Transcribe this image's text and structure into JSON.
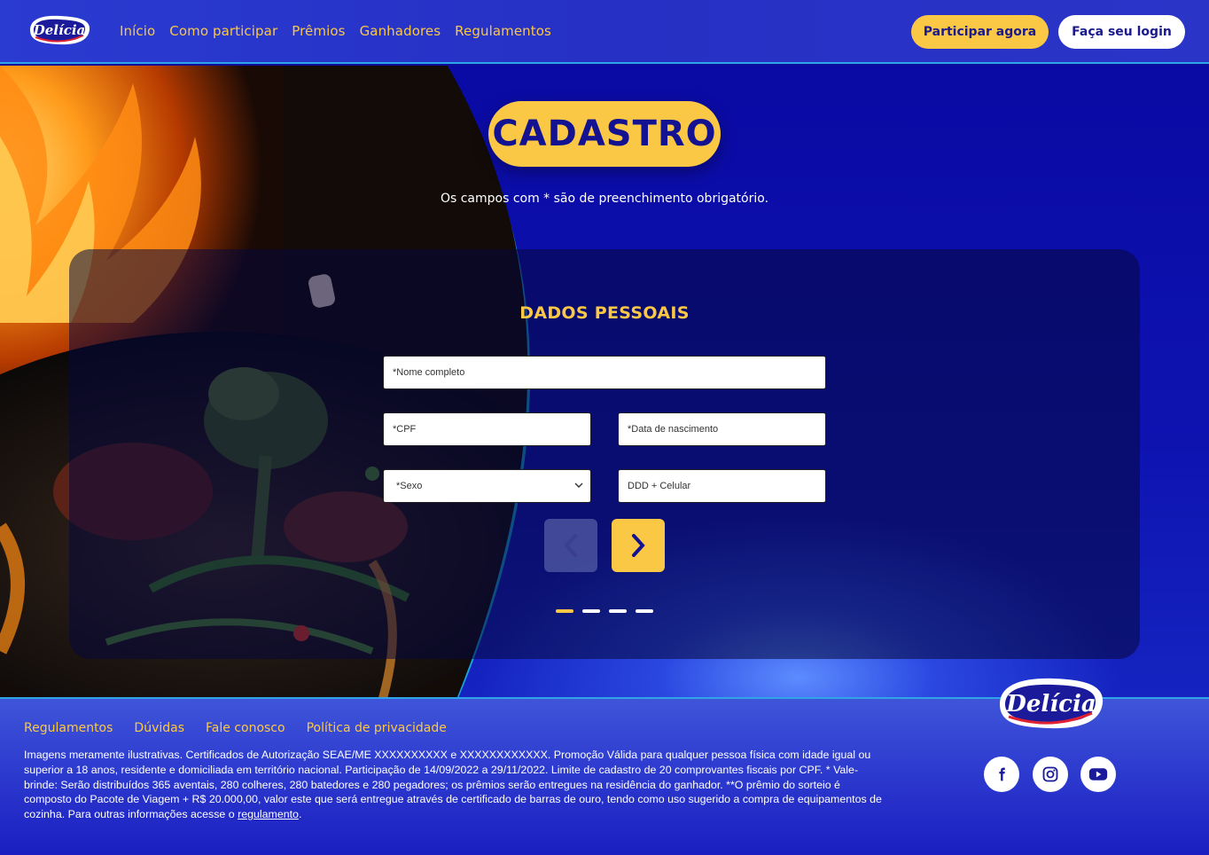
{
  "header": {
    "brand": "Delícia",
    "nav": [
      {
        "label": "Início"
      },
      {
        "label": "Como participar"
      },
      {
        "label": "Prêmios"
      },
      {
        "label": "Ganhadores"
      },
      {
        "label": "Regulamentos"
      }
    ],
    "participar_label": "Participar agora",
    "login_label": "Faça seu login"
  },
  "page": {
    "title": "CADASTRO",
    "subtitle": "Os campos com * são de preenchimento obrigatório."
  },
  "form": {
    "section_title": "DADOS PESSOAIS",
    "nome_placeholder": "*Nome completo",
    "cpf_placeholder": "*CPF",
    "nascimento_placeholder": "*Data de nascimento",
    "sexo_selected": "*Sexo",
    "celular_placeholder": "DDD + Celular",
    "steps_total": 4,
    "current_step": 1
  },
  "footer": {
    "links": [
      {
        "label": "Regulamentos"
      },
      {
        "label": "Dúvidas"
      },
      {
        "label": "Fale conosco"
      },
      {
        "label": "Política de privacidade"
      }
    ],
    "legal_text": "Imagens meramente ilustrativas. Certificados de Autorização SEAE/ME XXXXXXXXXX e XXXXXXXXXXXX. Promoção Válida para qualquer pessoa física com idade igual ou superior a 18 anos, residente e domiciliada em território nacional. Participação de 14/09/2022 a 29/11/2022. Limite de cadastro de 20 comprovantes fiscais por CPF. * Vale-brinde: Serão distribuídos 365 aventais, 280 colheres, 280 batedores  e 280 pegadores; os prêmios serão entregues na residência do ganhador. **O prêmio do sorteio é composto do Pacote de Viagem + R$ 20.000,00, valor este que será entregue através de certificado de barras de ouro, tendo como uso sugerido a compra de equipamentos de cozinha. Para outras informações acesse o ",
    "legal_link": "regulamento",
    "legal_end": ".",
    "social": [
      "facebook-icon",
      "instagram-icon",
      "youtube-icon"
    ]
  },
  "colors": {
    "accent_yellow": "#fbc846",
    "brand_blue": "#1a1a8e",
    "bg_blue": "#0d0d9e"
  }
}
